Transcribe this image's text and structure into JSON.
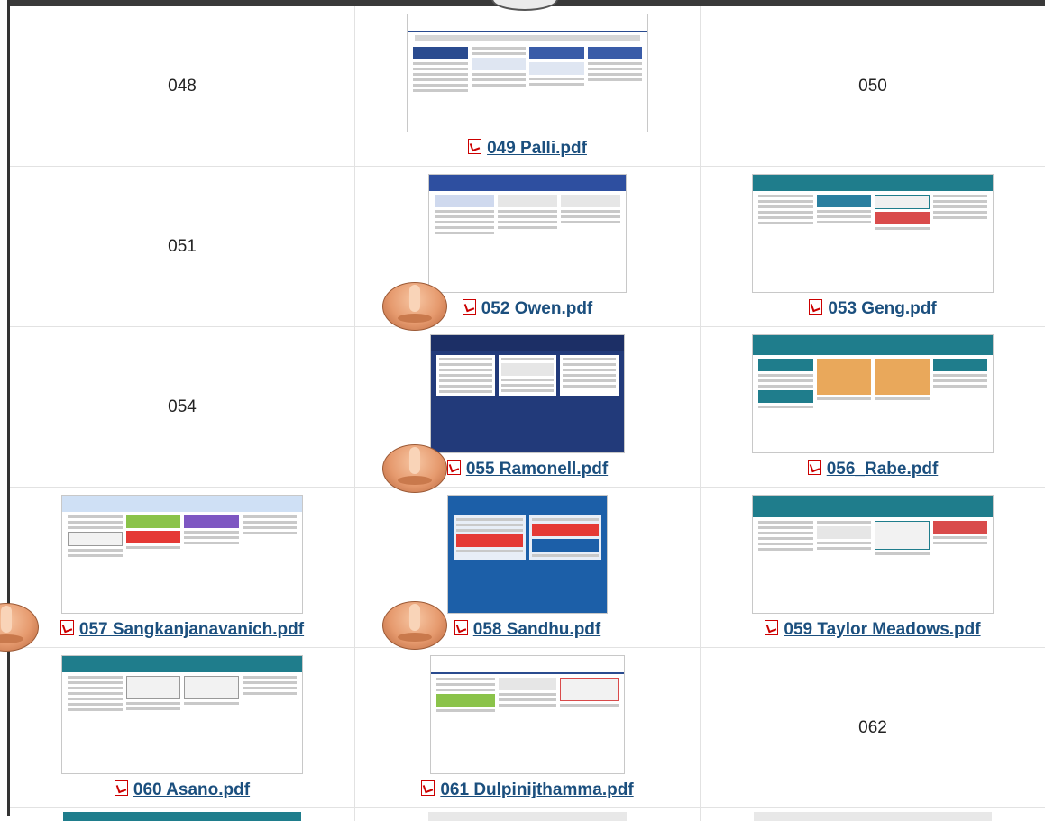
{
  "rows": [
    {
      "cells": [
        {
          "kind": "number",
          "text": "048"
        },
        {
          "kind": "file",
          "label": "049 Palli.pdf",
          "thumb": "light"
        },
        {
          "kind": "number",
          "text": "050"
        }
      ]
    },
    {
      "cells": [
        {
          "kind": "number",
          "text": "051"
        },
        {
          "kind": "file",
          "label": "052 Owen.pdf",
          "thumb": "light"
        },
        {
          "kind": "file",
          "label": "053 Geng.pdf",
          "thumb": "teal"
        }
      ]
    },
    {
      "cells": [
        {
          "kind": "number",
          "text": "054"
        },
        {
          "kind": "file",
          "label": "055 Ramonell.pdf",
          "thumb": "dark"
        },
        {
          "kind": "file",
          "label": "056_Rabe.pdf",
          "thumb": "teal"
        }
      ]
    },
    {
      "cells": [
        {
          "kind": "file",
          "label": "057 Sangkanjanavanich.pdf",
          "thumb": "light"
        },
        {
          "kind": "file",
          "label": "058 Sandhu.pdf",
          "thumb": "blue"
        },
        {
          "kind": "file",
          "label": "059 Taylor Meadows.pdf",
          "thumb": "teal"
        }
      ]
    },
    {
      "cells": [
        {
          "kind": "file",
          "label": "060 Asano.pdf",
          "thumb": "teal"
        },
        {
          "kind": "file",
          "label": "061 Dulpinijthamma.pdf",
          "thumb": "light"
        },
        {
          "kind": "number",
          "text": "062"
        }
      ]
    }
  ],
  "icons": {
    "file": "pdf-icon",
    "cursor": "nose-cursor-icon"
  },
  "colors": {
    "link": "#1b4f7e",
    "teal": "#1f7d8c",
    "navy": "#223a7a",
    "blue": "#1c5fa8",
    "pdf_red": "#cc0000"
  }
}
